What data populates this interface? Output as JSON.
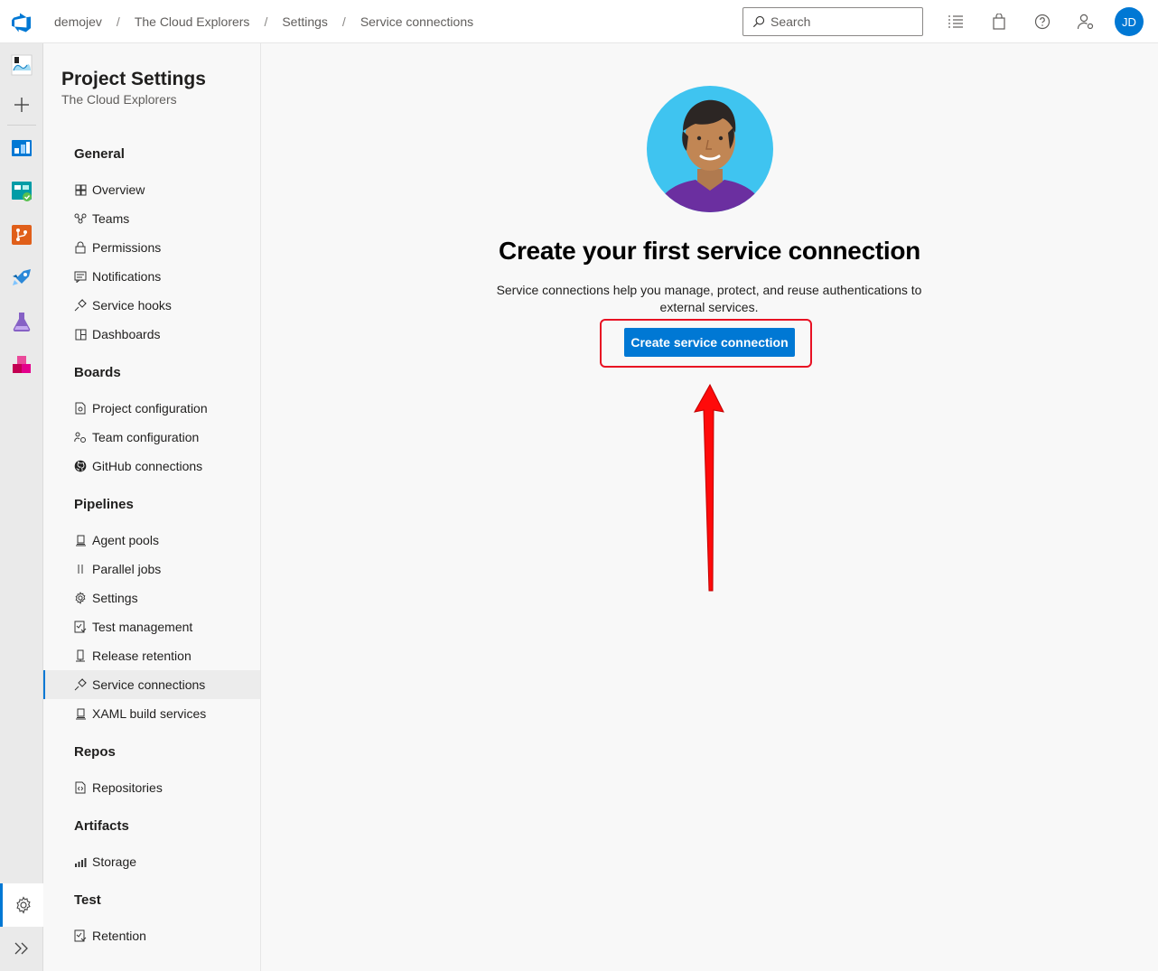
{
  "topbar": {
    "breadcrumbs": [
      "demojev",
      "The Cloud Explorers",
      "Settings",
      "Service connections"
    ],
    "separator": "/",
    "search_placeholder": "Search",
    "avatar_initials": "JD"
  },
  "nav": {
    "title": "Project Settings",
    "subtitle": "The Cloud Explorers",
    "groups": {
      "general": {
        "label": "General",
        "items": [
          "Overview",
          "Teams",
          "Permissions",
          "Notifications",
          "Service hooks",
          "Dashboards"
        ]
      },
      "boards": {
        "label": "Boards",
        "items": [
          "Project configuration",
          "Team configuration",
          "GitHub connections"
        ]
      },
      "pipelines": {
        "label": "Pipelines",
        "items": [
          "Agent pools",
          "Parallel jobs",
          "Settings",
          "Test management",
          "Release retention",
          "Service connections",
          "XAML build services"
        ]
      },
      "repos": {
        "label": "Repos",
        "items": [
          "Repositories"
        ]
      },
      "artifacts": {
        "label": "Artifacts",
        "items": [
          "Storage"
        ]
      },
      "test": {
        "label": "Test",
        "items": [
          "Retention"
        ]
      }
    },
    "active_item": "Service connections"
  },
  "main": {
    "headline": "Create your first service connection",
    "description": "Service connections help you manage, protect, and reuse authentications to external services.",
    "cta_label": "Create service connection"
  },
  "colors": {
    "accent": "#0078d4",
    "highlight": "#e81123",
    "hero_bg": "#3fc4f0",
    "shirt": "#6b2fa0"
  }
}
